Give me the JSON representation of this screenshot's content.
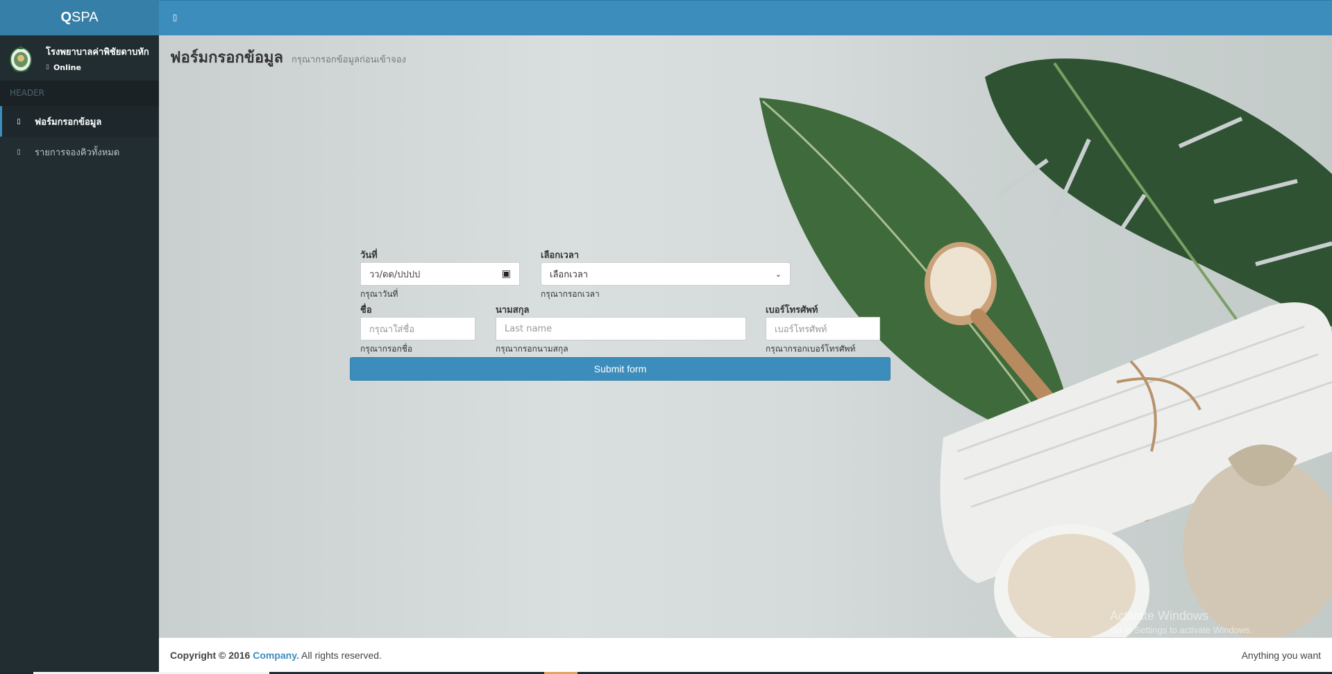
{
  "brand": {
    "logo_bold": "Q",
    "logo_rest": "SPA"
  },
  "user": {
    "name": "โรงพยาบาลค่าพิชัยดาบหัก",
    "status": "Online"
  },
  "sidebar": {
    "header": "HEADER",
    "items": [
      {
        "label": "ฟอร์มกรอกข้อมูล",
        "icon": "circle-icon",
        "active": true
      },
      {
        "label": "รายการจองคิวทั้งหมด",
        "icon": "circle-icon",
        "active": false
      }
    ]
  },
  "navbar": {
    "toggle_icon": "menu-toggle-icon"
  },
  "page": {
    "title": "ฟอร์มกรอกข้อมูล",
    "subtitle": "กรุณากรอกข้อมูลก่อนเข้าจอง"
  },
  "form": {
    "date": {
      "label": "วันที่",
      "value": "วว/ดด/ปปปป",
      "help": "กรุณาวันที่"
    },
    "time": {
      "label": "เลือกเวลา",
      "value": "เลือกเวลา",
      "help": "กรุณากรอกเวลา"
    },
    "first_name": {
      "label": "ชื่อ",
      "placeholder": "กรุณาใส่ชื่อ",
      "help": "กรุณากรอกชื่อ"
    },
    "last_name": {
      "label": "นามสกุล",
      "placeholder": "Last name",
      "help": "กรุณากรอกนามสกุล"
    },
    "phone": {
      "label": "เบอร์โทรศัพท์",
      "placeholder": "เบอร์โทรศัพท์",
      "help": "กรุณากรอกเบอร์โทรศัพท์"
    },
    "submit_label": "Submit form"
  },
  "watermark": {
    "line1": "Activate Windows",
    "line2": "Go to Settings to activate Windows."
  },
  "footer": {
    "copyright": "Copyright © 2016 ",
    "company": "Company.",
    "rights": " All rights reserved.",
    "right_text": "Anything you want"
  },
  "colors": {
    "primary": "#3c8dbc",
    "sidebar": "#222d32",
    "logo_bg": "#367fa9"
  }
}
